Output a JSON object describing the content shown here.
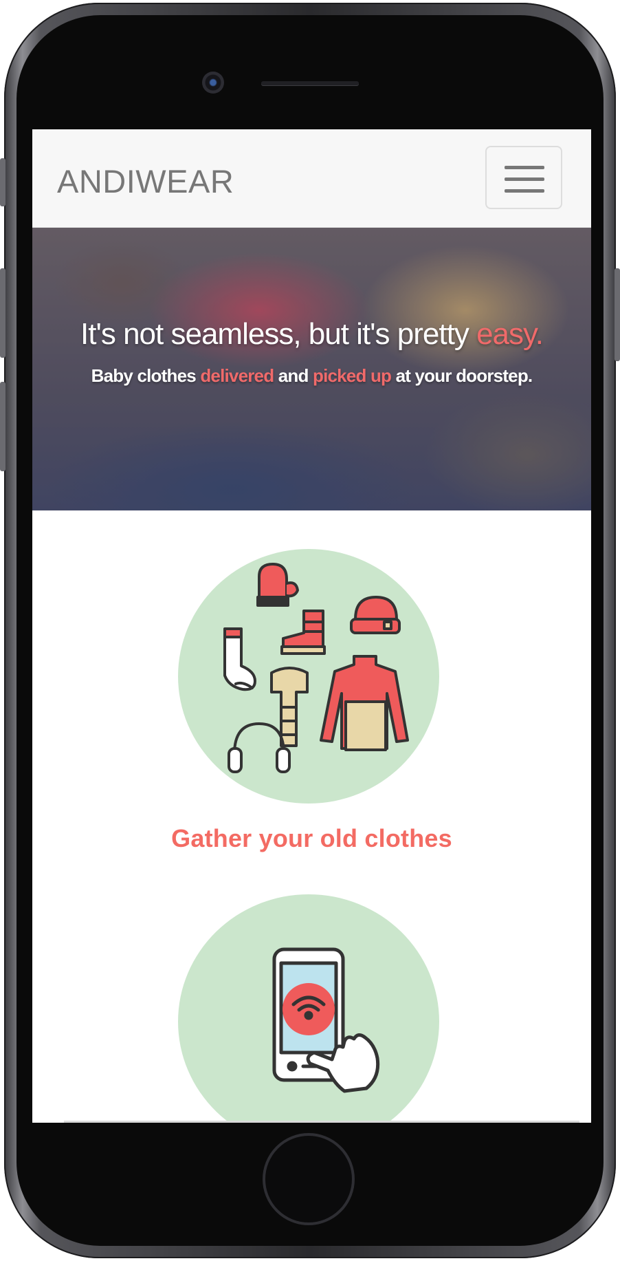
{
  "navbar": {
    "brand": "ANDIWEAR"
  },
  "hero": {
    "title_main": "It's not seamless, but it's pretty ",
    "title_accent": "easy.",
    "subtitle_part1": "Baby clothes ",
    "subtitle_accent1": "delivered",
    "subtitle_part2": " and ",
    "subtitle_accent2": "picked up",
    "subtitle_part3": " at your doorstep."
  },
  "steps": [
    {
      "caption": "Gather your old clothes",
      "icon": "clothes-icon"
    },
    {
      "caption": "",
      "icon": "phone-tap-icon"
    }
  ],
  "colors": {
    "accent": "#f36b63",
    "circle": "#cbe6cc",
    "navbar_bg": "#f7f7f7",
    "brand_text": "#777777"
  }
}
